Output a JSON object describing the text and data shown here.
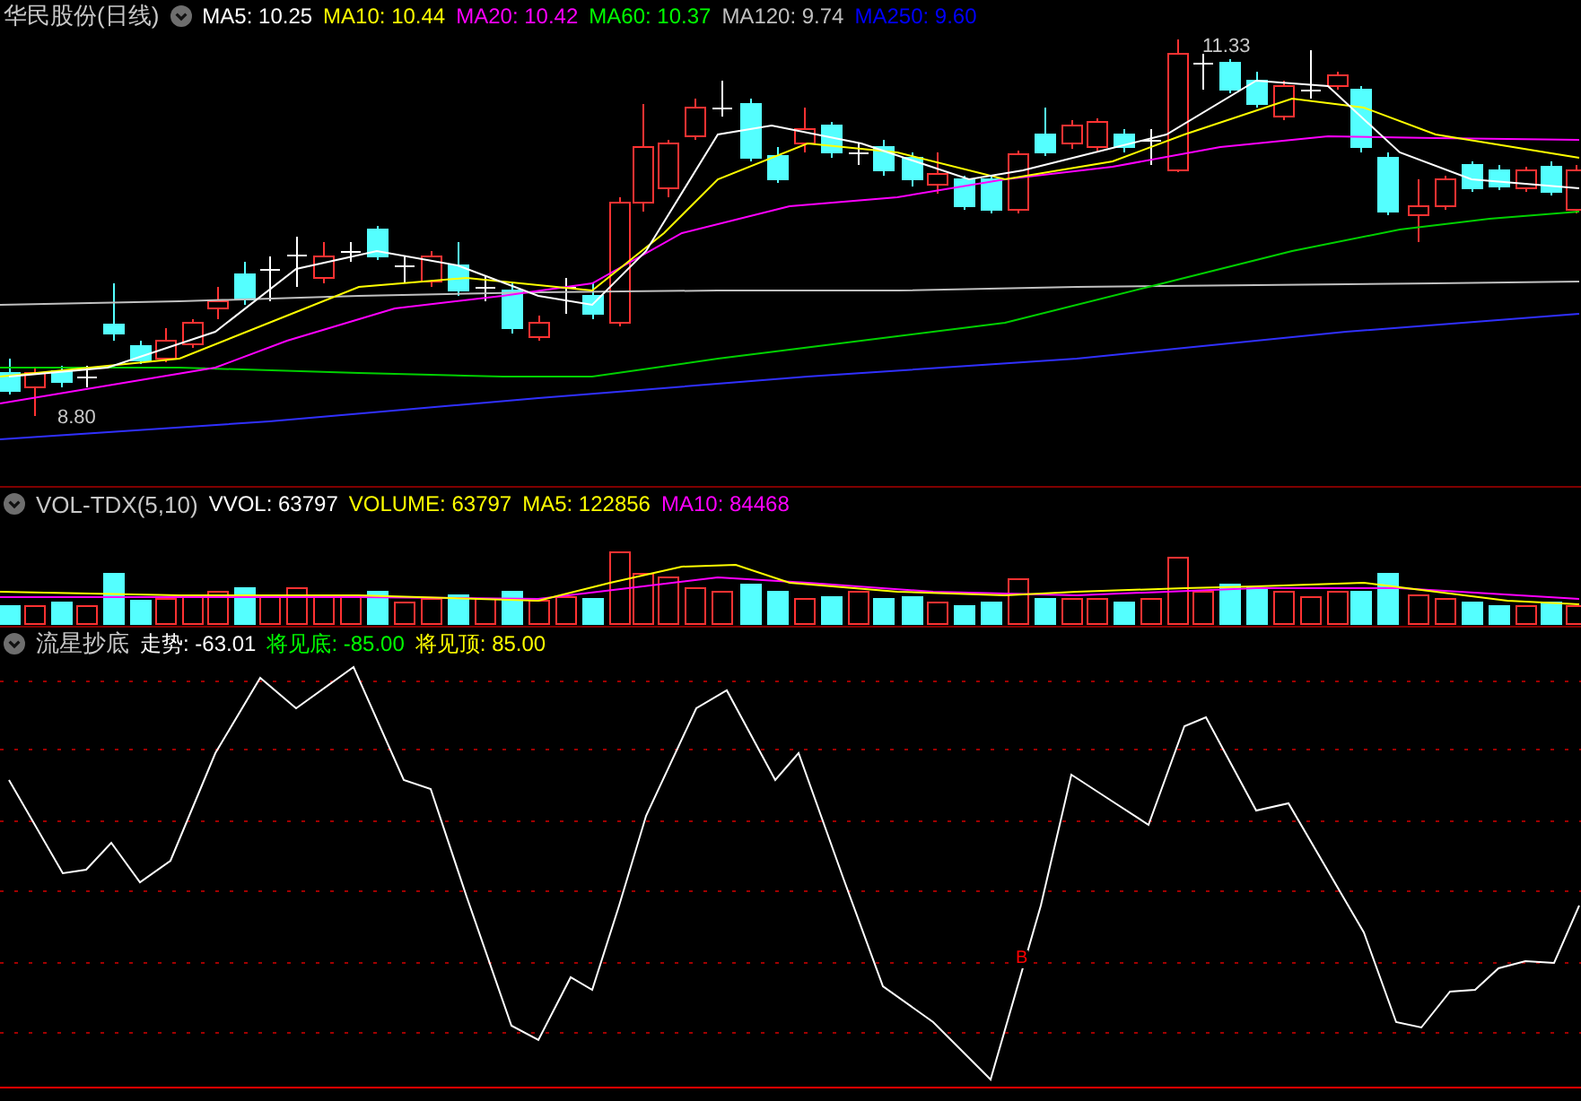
{
  "main_panel": {
    "title": "华民股份(日线)",
    "indicators": [
      {
        "label": "MA5: 10.25",
        "color": "#ffffff"
      },
      {
        "label": "MA10: 10.44",
        "color": "#ffff00"
      },
      {
        "label": "MA20: 10.42",
        "color": "#ff00ff"
      },
      {
        "label": "MA60: 10.37",
        "color": "#00ff00"
      },
      {
        "label": "MA120: 9.74",
        "color": "#c0c0c0"
      },
      {
        "label": "MA250: 9.60",
        "color": "#0000ff"
      }
    ],
    "price_labels": [
      {
        "kind": "high",
        "text": "11.33"
      },
      {
        "kind": "low",
        "text": "8.80"
      }
    ]
  },
  "volume_panel": {
    "title": "VOL-TDX(5,10)",
    "indicators": [
      {
        "label": "VVOL: 63797",
        "color": "#ffffff"
      },
      {
        "label": "VOLUME: 63797",
        "color": "#ffff00"
      },
      {
        "label": "MA5: 122856",
        "color": "#ffff00"
      },
      {
        "label": "MA10: 84468",
        "color": "#ff00ff"
      }
    ]
  },
  "indicator_panel": {
    "title": "流星抄底",
    "indicators": [
      {
        "label": "走势: -63.01",
        "color": "#ffffff"
      },
      {
        "label": "将见底: -85.00",
        "color": "#00ff00"
      },
      {
        "label": "将见顶: 85.00",
        "color": "#ffff00"
      }
    ],
    "signal": "B"
  }
}
